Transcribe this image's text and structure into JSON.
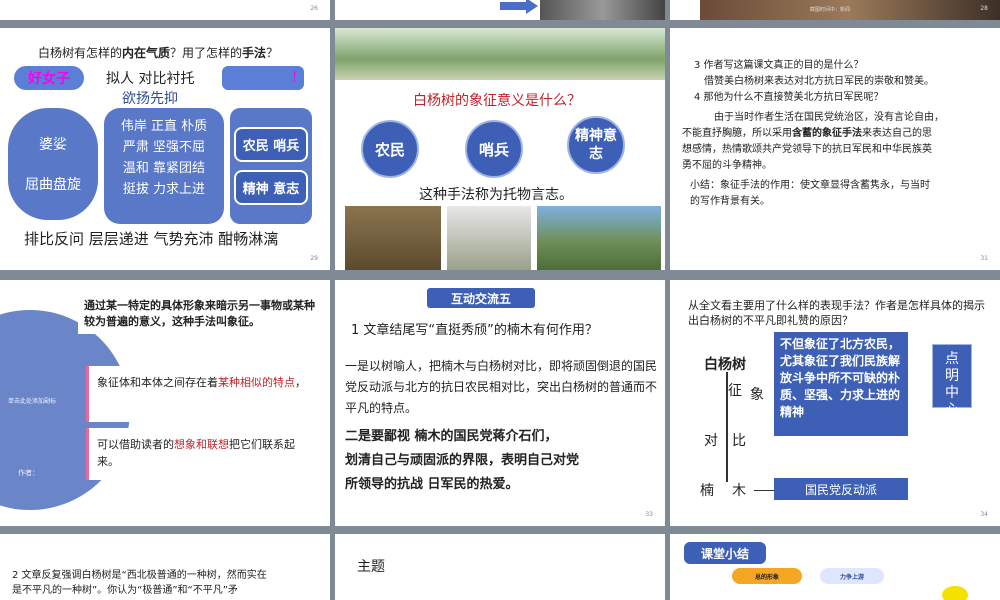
{
  "pages": {
    "p26": "26",
    "p28": "28",
    "p29": "29",
    "p31": "31",
    "p33": "33",
    "p34": "34"
  },
  "slide28": {
    "caption": "截图时间中：新闻"
  },
  "slide29": {
    "question_a": "白杨树有怎样的",
    "question_b": "内在气质",
    "question_c": "？用了怎样的",
    "question_d": "手法",
    "question_e": "？",
    "good_woman": "好女子",
    "techniques": "拟人  对比衬托",
    "yuyang": "欲扬先抑",
    "left_bubble_1": "婆娑",
    "left_bubble_2": "屈曲盘旋",
    "traits": [
      "伟岸 正直 朴质",
      "严肃  坚强不屈",
      "温和  靠紧团结",
      "挺拔  力求上进"
    ],
    "right_1": "农民 哨兵",
    "right_2": "精神 意志",
    "bottom": "排比反问 层层递进 气势充沛 酣畅淋漓"
  },
  "slide30": {
    "title": "白杨树的象征意义是什么？",
    "c1": "农民",
    "c2": "哨兵",
    "c3": "精神意志",
    "caption": "这种手法称为托物言志。"
  },
  "slide31": {
    "q3": "3  作者写这篇课文真正的目的是什么？",
    "a3": "借赞美白杨树来表达对北方抗日军民的崇敬和赞美。",
    "q4": "4  那他为什么不直接赞美北方抗日军民呢？",
    "a4_1": "由于当时作者生活在国民党统治区，没有言论自由，",
    "a4_2a": "不能直抒胸臆，所以采用",
    "a4_2b": "含蓄的象征手法",
    "a4_2c": "来表达自己的思",
    "a4_3": "想感情，热情歌颂共产党领导下的抗日军民和中华民族英",
    "a4_4": "勇不屈的斗争精神。",
    "summary_1": "小结：象征手法的作用：使文章显得含蓄隽永，与当时",
    "summary_2": "的写作背景有关。"
  },
  "slide32": {
    "definition": "通过某一特定的具体形象来暗示另一事物或某种较为普遍的意义，这种手法叫象征。",
    "box1_a": "象征体和本体之间存在着",
    "box1_b": "某种相似的特点",
    "box1_c": "，",
    "box2_a": "可以借助读者的",
    "box2_b": "想象和联想",
    "box2_c": "把它们联系起来。",
    "hint": "单击此处添加副标",
    "bottom_left": "作者："
  },
  "slide33": {
    "tag": "互动交流五",
    "q1": "1 文章结尾写“直挺秀颀”的楠木有何作用？",
    "p1": "一是以树喻人，把楠木与白杨树对比，即将顽固倒退的国民党反动派与北方的抗日农民相对比，突出白杨树的普通而不平凡的特点。",
    "p2_a": "二是要鄙视   楠木的国民党蒋介石们，",
    "p2_b": "划清自己与顽固派的界限，表明自己对党",
    "p2_c": "所领导的抗战   日军民的热爱。"
  },
  "slide34": {
    "question": "从全文看主要用了什么样的表现手法？作者是怎样具体的揭示出白杨树的不平凡即礼赞的原因？",
    "baiyang": "白杨树",
    "zheng": "征",
    "xiang": "象",
    "dui": "对",
    "bi": "比",
    "nan": "楠",
    "mu": "木",
    "box_text": "不但象征了北方农民，尤其象征了我们民族解放斗争中所不可缺的朴质、坚强、力求上进的精神",
    "side": "点明中心",
    "gmd": "国民党反动派"
  },
  "slide35": {
    "text_1": "2  文章反复强调白杨树是“西北极普通的一种树，然而实在",
    "text_2": "是不平凡的一种树”。你认为“极普通”和“不平凡”矛"
  },
  "slide36": {
    "title": "主题"
  },
  "slide37": {
    "tag": "课堂小结",
    "chip1": "总的形象",
    "chip2": "力争上游"
  }
}
